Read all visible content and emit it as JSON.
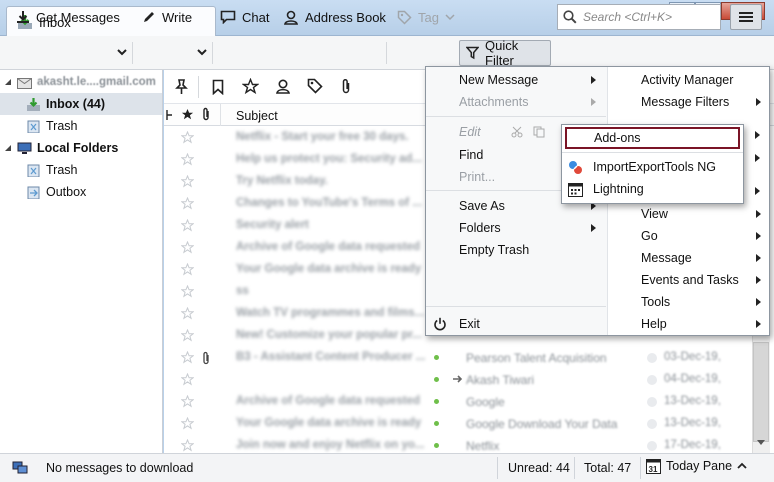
{
  "window": {
    "tab_title": "Inbox",
    "colors": {
      "chrome": "#b9d1ea",
      "highlight_border": "#7a1426",
      "selected_folder": "#dde3ea"
    }
  },
  "toolbar": {
    "get_messages": "Get Messages",
    "write": "Write",
    "chat": "Chat",
    "address_book": "Address Book",
    "tag": "Tag",
    "quick_filter": "Quick Filter",
    "search_placeholder": "Search <Ctrl+K>"
  },
  "folders": {
    "account": "akasht.le....gmail.com",
    "inbox": "Inbox (44)",
    "trash": "Trash",
    "local_folders": "Local Folders",
    "local_trash": "Trash",
    "outbox": "Outbox"
  },
  "columns": {
    "subject": "Subject"
  },
  "messages": [
    {
      "subject": "Netflix - Start your free 30 days.",
      "from": "",
      "date": ""
    },
    {
      "subject": "Help us protect you: Security ad...",
      "from": "",
      "date": ""
    },
    {
      "subject": "Try Netflix today.",
      "from": "",
      "date": ""
    },
    {
      "subject": "Changes to YouTube's Terms of ...",
      "from": "",
      "date": ""
    },
    {
      "subject": "Security alert",
      "from": "",
      "date": ""
    },
    {
      "subject": "Archive of Google data requested",
      "from": "",
      "date": ""
    },
    {
      "subject": "Your Google data archive is ready",
      "from": "",
      "date": ""
    },
    {
      "subject": "ss",
      "from": "",
      "date": ""
    },
    {
      "subject": "Watch TV programmes and films...",
      "from": "",
      "date": ""
    },
    {
      "subject": "New! Customize your popular pr...",
      "from": "",
      "date": ""
    },
    {
      "subject": "B3 - Assistant Content Producer ...",
      "from": "Pearson Talent Acquisition",
      "date": "03-Dec-19,"
    },
    {
      "subject": "",
      "from": "Akash  Tiwari",
      "date": "04-Dec-19,"
    },
    {
      "subject": "Archive of Google data requested",
      "from": "Google",
      "date": "13-Dec-19,"
    },
    {
      "subject": "Your Google data archive is ready",
      "from": "Google Download Your Data",
      "date": "13-Dec-19,"
    },
    {
      "subject": "Join now and enjoy Netflix on yo...",
      "from": "Netflix",
      "date": "17-Dec-19,"
    }
  ],
  "app_menu": {
    "left": {
      "new_message": "New Message",
      "attachments": "Attachments",
      "edit": "Edit",
      "find": "Find",
      "print": "Print...",
      "save_as": "Save As",
      "folders": "Folders",
      "empty_trash": "Empty Trash",
      "exit": "Exit"
    },
    "right": {
      "activity_manager": "Activity Manager",
      "message_filters": "Message Filters",
      "view": "View",
      "go": "Go",
      "message": "Message",
      "events_tasks": "Events and Tasks",
      "tools": "Tools",
      "help": "Help"
    }
  },
  "submenu": {
    "addons": "Add-ons",
    "import_export": "ImportExportTools NG",
    "lightning": "Lightning"
  },
  "status": {
    "message": "No messages to download",
    "unread": "Unread: 44",
    "total": "Total: 47",
    "today_pane": "Today Pane"
  }
}
